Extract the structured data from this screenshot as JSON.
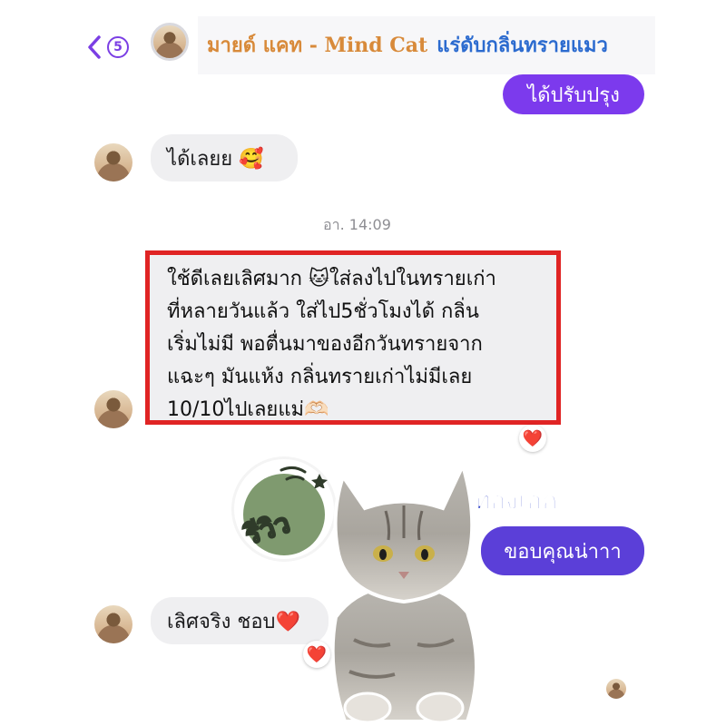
{
  "header": {
    "back_count": "5",
    "shop_name": "มายด์ แคท - Mind Cat",
    "description": "แร่ดับกลิ่นทรายแมว"
  },
  "messages": {
    "out_top": "ได้ปรับปรุง",
    "in_1": "ได้เลยย 🥰",
    "timestamp": "อา. 14:09",
    "review_lines": [
      "ใช้ดีเลยเลิศมาก 🐱ใส่ลงไปในทรายเก่า",
      "ที่หลายวันแล้ว ใส่ไป5ชั่วโมงได้ กลิ่น",
      "เริ่มไม่มี พอตื่นมาของอีกวันทรายจาก",
      "แฉะๆ มันแห้ง กลิ่นทรายเก่าไม่มีเลย",
      "10/10ไปเลยแม่🫶🏻"
    ],
    "out_thanks": "ขอบคุณน่าาา",
    "in_last": "เลิศจริง ชอบ❤️",
    "heart": "❤️"
  },
  "sticker": {
    "review_label": "รีวิว",
    "cat_name": "ทองเอก"
  },
  "colors": {
    "accent_purple": "#7c3aed",
    "highlight_red": "#e02424"
  }
}
